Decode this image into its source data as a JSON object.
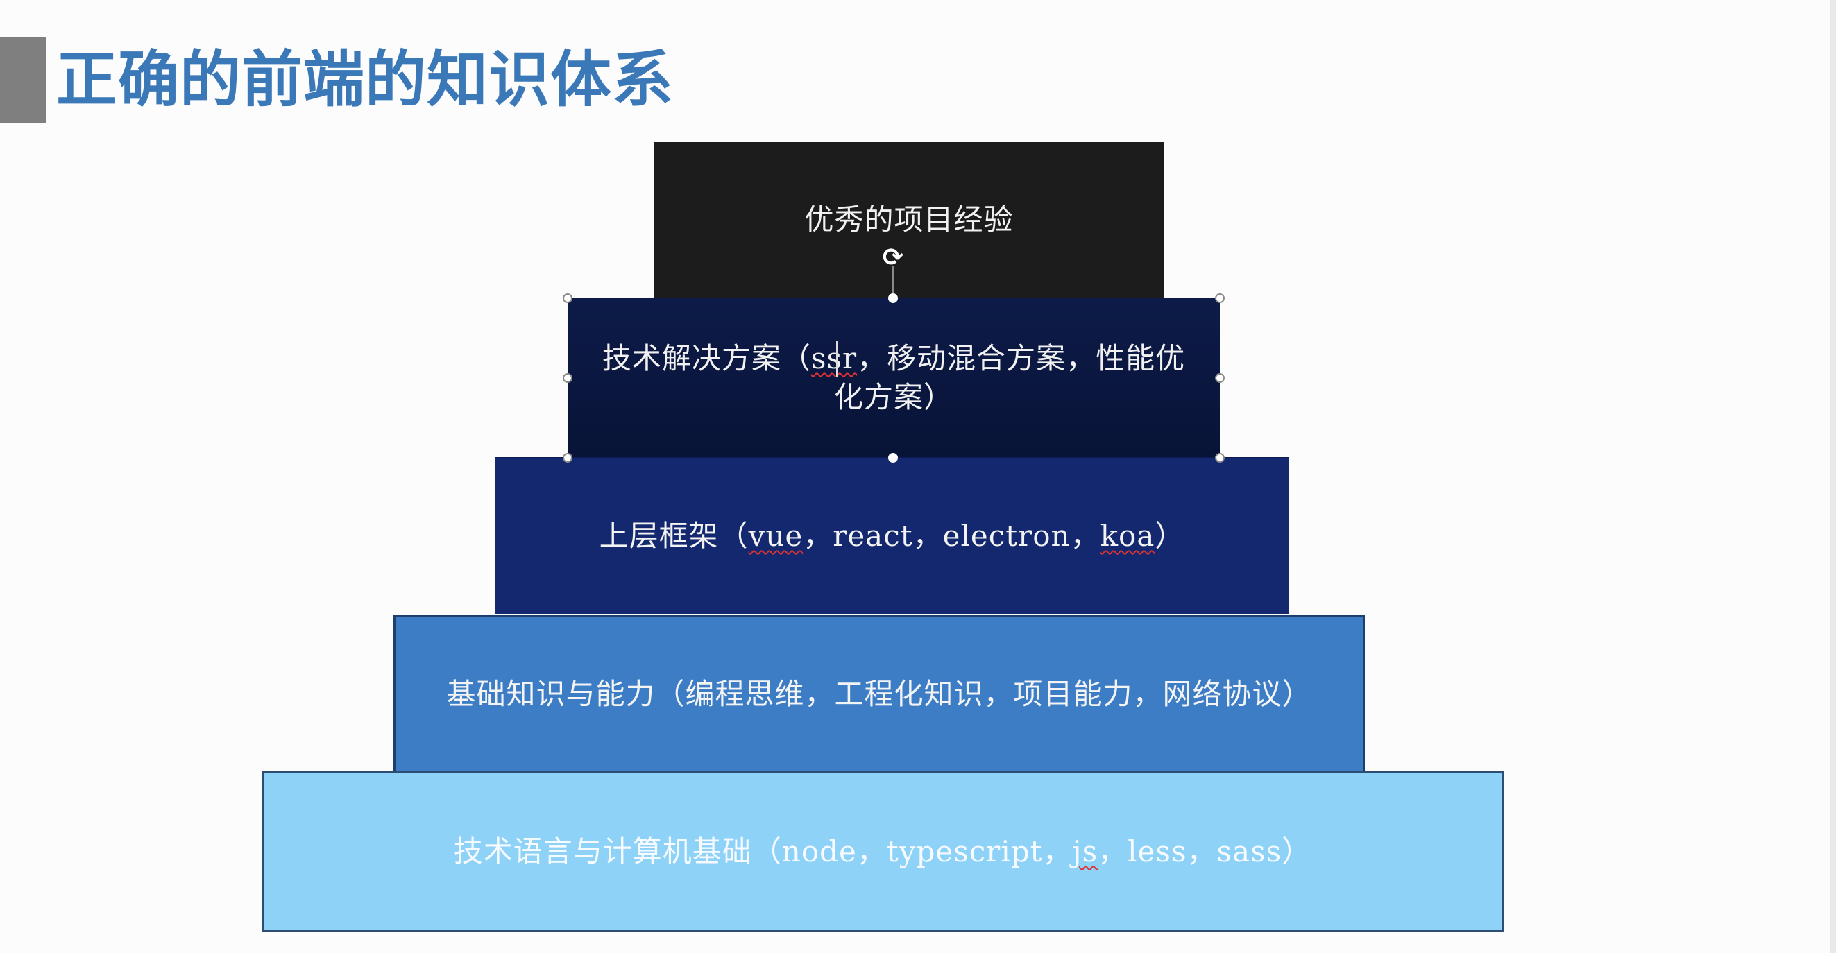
{
  "slide": {
    "title": "正确的前端的知识体系"
  },
  "pyramid": {
    "layers": [
      {
        "label": "优秀的项目经验"
      },
      {
        "label_line1_pre": "技术解决方案（",
        "label_line1_sq": "ssr",
        "label_line1_post": "，移动混合方案，性能优",
        "label_line2": "化方案）"
      },
      {
        "label_pre": "上层框架（",
        "label_sq1": "vue",
        "label_mid": "，react，electron，",
        "label_sq2": "koa",
        "label_post": "）"
      },
      {
        "label": "基础知识与能力（编程思维，工程化知识，项目能力，网络协议）"
      },
      {
        "label_pre": "技术语言与计算机基础（node，typescript，",
        "label_sq": "js",
        "label_post": "，less，sass）"
      }
    ]
  },
  "colors": {
    "title": "#3a78b8",
    "layer_1": "#1c1c1c",
    "layer_2": "#0b1841",
    "layer_3": "#13286e",
    "layer_4": "#3c7dc6",
    "layer_5": "#8fd2f8"
  },
  "selection": {
    "rotate_icon": "rotate-icon"
  }
}
